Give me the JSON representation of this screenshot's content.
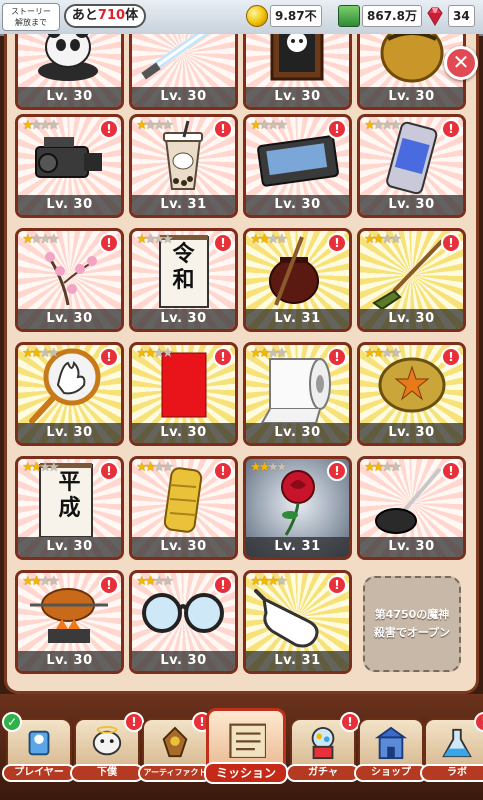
{
  "topbar": {
    "story_label_line1": "ストーリー",
    "story_label_line2": "解放まで",
    "remaining_prefix": "あと",
    "remaining_count": "710",
    "remaining_suffix": "体",
    "coins": "9.87不",
    "food": "867.8万",
    "gems": "34"
  },
  "colors": {
    "frame": "#7b2e1c",
    "alert": "#e8303a",
    "panel": "#f3dcc6",
    "star_on": "#f5b800"
  },
  "items": [
    {
      "id": "panda",
      "icon": "panda-figurine",
      "level_label": "Lv. 30",
      "stars": 0,
      "alert": false,
      "bg": "red"
    },
    {
      "id": "lightsaber",
      "icon": "lightsaber",
      "level_label": "Lv. 30",
      "stars": 0,
      "alert": false,
      "bg": "red"
    },
    {
      "id": "portrait",
      "icon": "framed-portrait",
      "level_label": "Lv. 30",
      "stars": 0,
      "alert": false,
      "bg": "red"
    },
    {
      "id": "pot",
      "icon": "golden-pot",
      "level_label": "Lv. 30",
      "stars": 0,
      "alert": false,
      "bg": "red"
    },
    {
      "id": "camcorder",
      "icon": "video-camera",
      "level_label": "Lv. 30",
      "stars": 1,
      "alert": true,
      "bg": "red"
    },
    {
      "id": "bubbletea",
      "icon": "bubble-tea",
      "level_label": "Lv. 31",
      "stars": 1,
      "alert": true,
      "bg": "red"
    },
    {
      "id": "cassette",
      "icon": "game-cassette",
      "level_label": "Lv. 30",
      "stars": 1,
      "alert": true,
      "bg": "red"
    },
    {
      "id": "boss",
      "icon": "boss-drink-can",
      "level_label": "Lv. 30",
      "stars": 1,
      "alert": true,
      "bg": "red"
    },
    {
      "id": "plum",
      "icon": "plum-blossom",
      "level_label": "Lv. 30",
      "stars": 1,
      "alert": true,
      "bg": "red"
    },
    {
      "id": "reiwa",
      "icon": "reiwa-sign",
      "level_label": "Lv. 30",
      "stars": 1,
      "alert": true,
      "bg": "red",
      "sign_char1": "令",
      "sign_char2": "和"
    },
    {
      "id": "urn",
      "icon": "urn-and-stick",
      "level_label": "Lv. 31",
      "stars": 2,
      "alert": true,
      "bg": "gold"
    },
    {
      "id": "broom",
      "icon": "broom",
      "level_label": "Lv. 30",
      "stars": 2,
      "alert": true,
      "bg": "gold"
    },
    {
      "id": "hand-fan",
      "icon": "hand-fan",
      "level_label": "Lv. 30",
      "stars": 2,
      "alert": true,
      "bg": "gold"
    },
    {
      "id": "red-card",
      "icon": "red-card",
      "level_label": "Lv. 30",
      "stars": 2,
      "alert": true,
      "bg": "gold"
    },
    {
      "id": "toilet-paper",
      "icon": "toilet-paper",
      "level_label": "Lv. 30",
      "stars": 2,
      "alert": true,
      "bg": "gold"
    },
    {
      "id": "bottle-cap",
      "icon": "bottle-cap-star",
      "level_label": "Lv. 30",
      "stars": 2,
      "alert": true,
      "bg": "gold"
    },
    {
      "id": "heisei",
      "icon": "heisei-sign",
      "level_label": "Lv. 30",
      "stars": 2,
      "alert": true,
      "bg": "red",
      "sign_char1": "平",
      "sign_char2": "成"
    },
    {
      "id": "gold-bar",
      "icon": "gold-bar",
      "level_label": "Lv. 30",
      "stars": 2,
      "alert": true,
      "bg": "red"
    },
    {
      "id": "rose",
      "icon": "red-rose",
      "level_label": "Lv. 31",
      "stars": 2,
      "alert": true,
      "bg": "dark"
    },
    {
      "id": "plunger",
      "icon": "plunger",
      "level_label": "Lv. 30",
      "stars": 2,
      "alert": true,
      "bg": "red"
    },
    {
      "id": "roast-chicken",
      "icon": "roast-chicken",
      "level_label": "Lv. 30",
      "stars": 2,
      "alert": true,
      "bg": "red"
    },
    {
      "id": "glasses",
      "icon": "round-glasses",
      "level_label": "Lv. 30",
      "stars": 2,
      "alert": true,
      "bg": "red"
    },
    {
      "id": "pointing-hand",
      "icon": "pointing-hand",
      "level_label": "Lv. 31",
      "stars": 3,
      "alert": true,
      "bg": "gold"
    }
  ],
  "locked_slot": {
    "line1": "第4750の魔神",
    "line2": "殺害でオープン"
  },
  "close_icon": "close-x-icon",
  "bottom_nav": [
    {
      "id": "player",
      "label": "プレイヤー",
      "icon": "player-icon",
      "badge": "check"
    },
    {
      "id": "servant",
      "label": "下僕",
      "icon": "servant-icon",
      "badge": "alert"
    },
    {
      "id": "artifact",
      "label": "アーティファクト",
      "icon": "artifact-icon",
      "badge": "alert"
    },
    {
      "id": "mission",
      "label": "ミッション",
      "icon": "mission-scroll-icon",
      "badge": "none"
    },
    {
      "id": "gacha",
      "label": "ガチャ",
      "icon": "gacha-machine-icon",
      "badge": "alert"
    },
    {
      "id": "shop",
      "label": "ショップ",
      "icon": "shop-castle-icon",
      "badge": "none"
    },
    {
      "id": "lab",
      "label": "ラボ",
      "icon": "lab-flask-icon",
      "badge": "alert"
    }
  ],
  "alert_glyph": "!",
  "check_glyph": "✓"
}
